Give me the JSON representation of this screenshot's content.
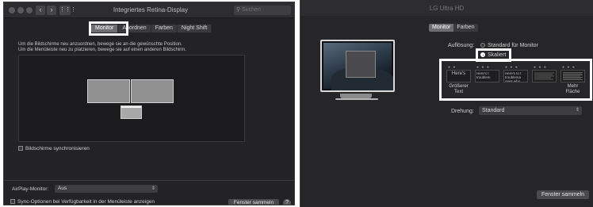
{
  "left": {
    "window_title": "Integriertes Retina-Display",
    "search_placeholder": "Suchen",
    "tabs": [
      {
        "label": "Monitor",
        "active": true
      },
      {
        "label": "Anordnen",
        "active": false
      },
      {
        "label": "Farben",
        "active": false
      },
      {
        "label": "Night Shift",
        "active": false
      }
    ],
    "info_line1": "Um die Bildschirme neu anzuordnen, bewege sie an die gewünschte Position.",
    "info_line2": "Um die Menüleiste neu zu platzieren, bewege sie auf einen anderen Bildschirm.",
    "mirror_label": "Bildschirme synchronisieren",
    "airplay_label": "AirPlay-Monitor:",
    "airplay_value": "Aus",
    "sync_options_label": "Sync-Optionen bei Verfügbarkeit in der Menüleiste anzeigen",
    "gather_button": "Fenster sammeln",
    "help_button": "?"
  },
  "right": {
    "window_title": "LG Ultra HD",
    "tabs": [
      {
        "label": "Monitor",
        "active": true
      },
      {
        "label": "Farben",
        "active": false
      }
    ],
    "resolution_label": "Auflösung:",
    "option_default": "Standard für Monitor",
    "option_scaled": "Skaliert",
    "scale_options": [
      {
        "thumb_text": "Here's",
        "caption": "Größerer Text"
      },
      {
        "thumb_text": "Here's t troublem",
        "caption": ""
      },
      {
        "thumb_text": "Here's to t troublema ones who",
        "caption": ""
      },
      {
        "thumb_text": "",
        "caption": ""
      },
      {
        "thumb_text": "",
        "caption": "Mehr Fläche"
      }
    ],
    "rotation_label": "Drehung:",
    "rotation_value": "Standard",
    "gather_button": "Fenster sammeln"
  },
  "colors": {
    "highlight": "#ffffff",
    "window_bg": "#232325",
    "active_tab": "#6e6e70"
  },
  "icons": [
    "close-icon",
    "back-arrow-icon",
    "forward-arrow-icon",
    "grid-icon",
    "search-icon",
    "chevron-updown-icon",
    "help-icon"
  ]
}
